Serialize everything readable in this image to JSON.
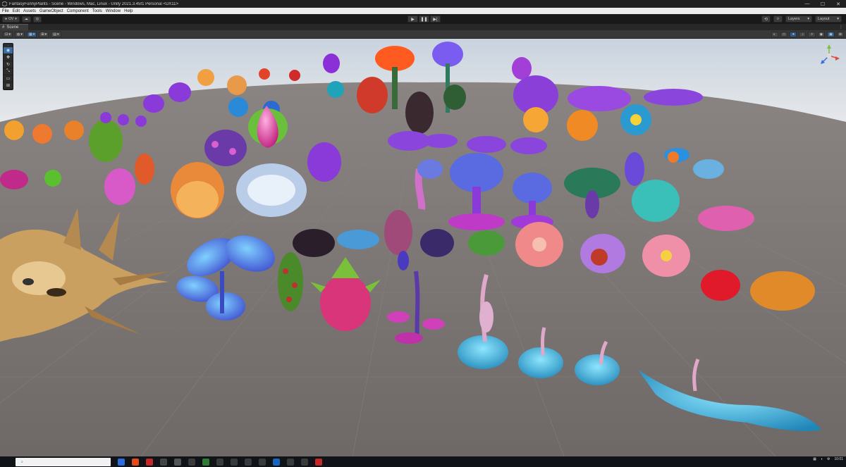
{
  "window": {
    "title": "FantasyFunnyPlants - Scene - Windows, Mac, Linux - Unity 2021.3.45f1 Personal <DX11>",
    "minimize": "—",
    "maximize": "☐",
    "close": "✕"
  },
  "menu": [
    "File",
    "Edit",
    "Assets",
    "GameObject",
    "Component",
    "Tools",
    "Window",
    "Help"
  ],
  "toolbar": {
    "account_label": "OV",
    "layers_label": "Layers",
    "layout_label": "Layout"
  },
  "scene_tab": {
    "label": "Scene"
  },
  "taskbar": {
    "time": "10:01"
  },
  "colors": {
    "ground": "#7a7472",
    "horizon": "#d9dde3",
    "selected_tool": "#3a6ea5"
  }
}
